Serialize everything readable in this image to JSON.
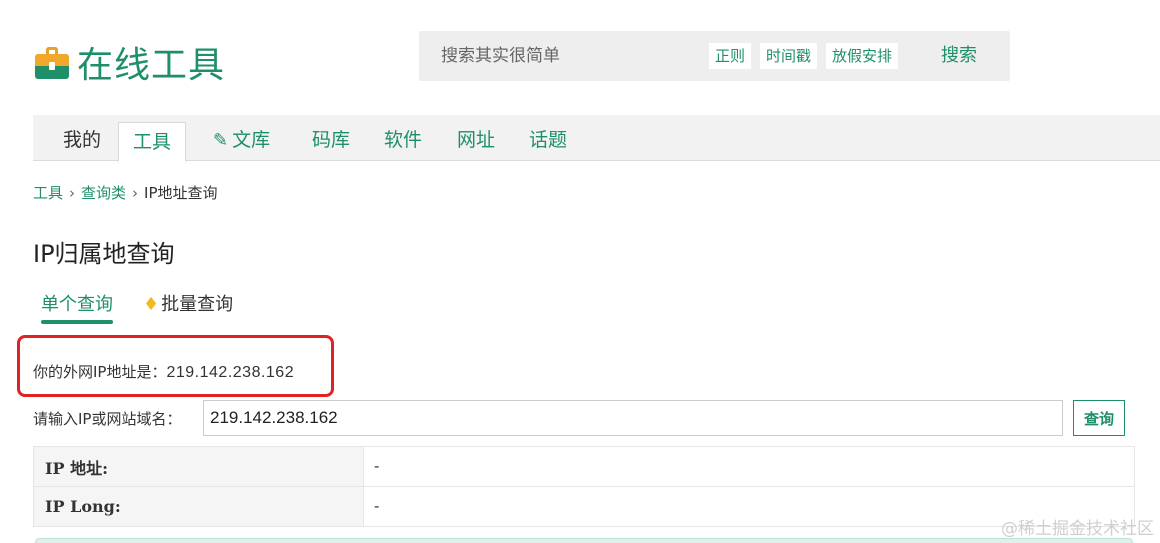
{
  "header": {
    "logo_text": "在线工具",
    "search": {
      "placeholder": "搜索其实很简单",
      "tags": [
        "正则",
        "时间戳",
        "放假安排"
      ],
      "button_label": "搜索"
    }
  },
  "nav": {
    "items": [
      {
        "label": "我的"
      },
      {
        "label": "工具"
      },
      {
        "label": "文库"
      },
      {
        "label": "码库"
      },
      {
        "label": "软件"
      },
      {
        "label": "网址"
      },
      {
        "label": "话题"
      }
    ],
    "active": "工具"
  },
  "breadcrumb": {
    "items": [
      "工具",
      "查询类",
      "IP地址查询"
    ],
    "separator": "›"
  },
  "page_title": "IP归属地查询",
  "subtabs": {
    "single": "单个查询",
    "batch": "批量查询"
  },
  "your_ip": {
    "label": "你的外网IP地址是：",
    "value": "219.142.238.162"
  },
  "query": {
    "label": "请输入IP或网站域名：",
    "value": "219.142.238.162",
    "button_label": "查询"
  },
  "results": [
    {
      "key": "IP 地址:",
      "value": "-"
    },
    {
      "key": "IP Long:",
      "value": "-"
    }
  ],
  "watermark": "@稀土掘金技术社区",
  "colors": {
    "brand_green": "#1f8f6a",
    "highlight_red": "#e22222",
    "gem_gold": "#f2b91f"
  }
}
